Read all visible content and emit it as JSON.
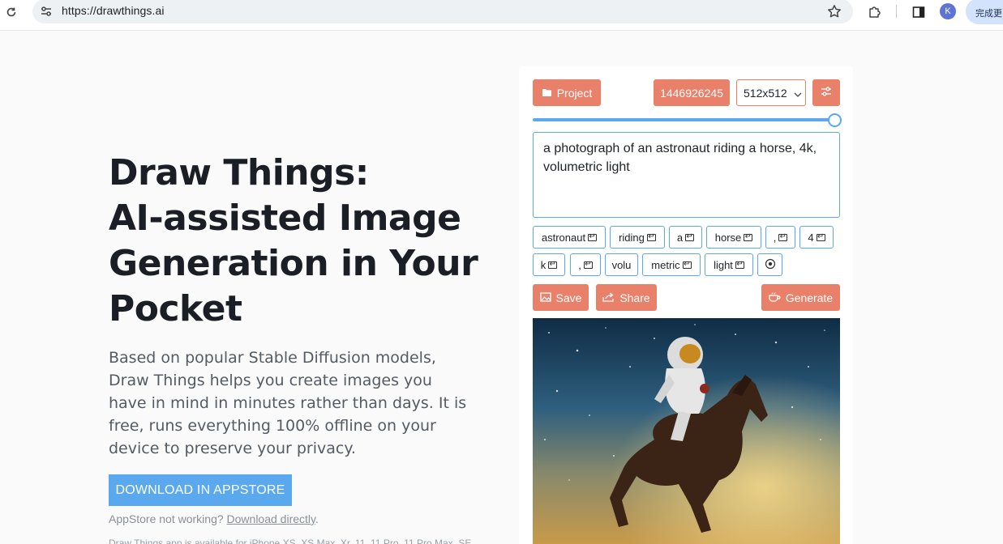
{
  "browser": {
    "url": "https://drawthings.ai",
    "profile_initial": "K",
    "update_label": "完成更"
  },
  "hero": {
    "title_lines": [
      "Draw Things:",
      "AI-assisted Image",
      "Generation in Your",
      "Pocket"
    ],
    "description": "Based on popular Stable Diffusion models, Draw Things helps you create images you have in mind in minutes rather than days. It is free, runs everything 100% offline on your device to preserve your privacy.",
    "download_label": "DOWNLOAD IN APPSTORE",
    "appstore_note_prefix": "AppStore not working? ",
    "download_directly_label": "Download directly",
    "appstore_note_suffix": ".",
    "available_note": "Draw Things app is available for iPhone XS, XS Max, Xr, 11, 11 Pro, 11 Pro Max, SE"
  },
  "demo": {
    "project_label": "Project",
    "seed": "1446926245",
    "size_value": "512x512",
    "slider_fraction": 1.0,
    "prompt": "a photograph of an astronaut riding a horse, 4k, volumetric light",
    "tokens_row1": [
      "astronaut",
      "riding",
      "a",
      "horse",
      ",",
      "4"
    ],
    "tokens_row2": [
      "k",
      ",",
      "volu",
      "metric",
      "light"
    ],
    "save_label": "Save",
    "share_label": "Share",
    "generate_label": "Generate",
    "accent_color": "#e8806a",
    "highlight_color": "#5aa9ef"
  },
  "icons": {
    "reload": "reload-icon",
    "site_info": "tune-icon",
    "bookmark": "star-icon",
    "extensions": "puzzle-icon",
    "side_panel": "side-panel-icon",
    "folder": "folder-icon",
    "settings": "sliders-icon",
    "image": "image-icon",
    "share": "share-icon",
    "generate": "cup-icon",
    "enter": "enter-icon",
    "stop": "stop-circle-icon"
  }
}
